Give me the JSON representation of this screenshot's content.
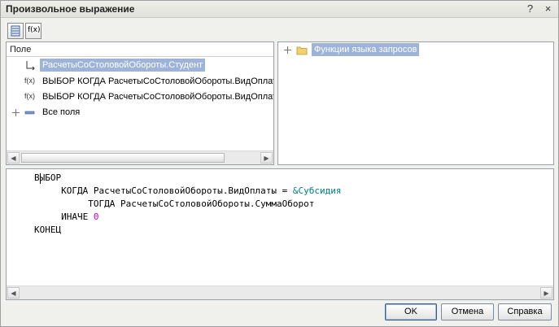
{
  "window": {
    "title": "Произвольное выражение",
    "help_glyph": "?",
    "close_glyph": "×"
  },
  "toolbar": {
    "buttons": [
      {
        "icon": "list-icon"
      },
      {
        "icon": "function-icon",
        "glyph": "f(x)"
      }
    ]
  },
  "fields_panel": {
    "header": "Поле",
    "rows": [
      {
        "icon": "hierarchy-icon",
        "glyph": "⌐",
        "label": "РасчетыСоСтоловойОбороты.Студент",
        "selected": true
      },
      {
        "icon": "function-icon",
        "glyph": "f(x)",
        "label": "ВЫБОР КОГДА РасчетыСоСтоловойОбороты.ВидОплаты",
        "selected": false
      },
      {
        "icon": "function-icon",
        "glyph": "f(x)",
        "label": "ВЫБОР КОГДА РасчетыСоСтоловойОбороты.ВидОплаты",
        "selected": false
      },
      {
        "icon": "minus-field-icon",
        "glyph": "−",
        "label": "Все поля",
        "selected": false,
        "expandable": true
      }
    ]
  },
  "functions_panel": {
    "rows": [
      {
        "icon": "folder-icon",
        "label": "Функции языка запросов",
        "selected": true,
        "expandable": true
      }
    ]
  },
  "editor": {
    "lines": [
      {
        "indent": "",
        "parts": [
          {
            "t": "ВЫБОР",
            "c": "kw"
          }
        ]
      },
      {
        "indent": "     ",
        "parts": [
          {
            "t": "КОГДА РасчетыСоСтоловойОбороты.ВидОплаты = ",
            "c": "kw"
          },
          {
            "t": "&Субсидия",
            "c": "param"
          }
        ]
      },
      {
        "indent": "          ",
        "parts": [
          {
            "t": "ТОГДА РасчетыСоСтоловойОбороты.СуммаОборот",
            "c": "kw"
          }
        ]
      },
      {
        "indent": "     ",
        "parts": [
          {
            "t": "ИНАЧЕ ",
            "c": "kw"
          },
          {
            "t": "0",
            "c": "num"
          }
        ]
      },
      {
        "indent": "",
        "parts": [
          {
            "t": "КОНЕЦ",
            "c": "kw"
          }
        ]
      }
    ]
  },
  "buttons": {
    "ok": "OK",
    "cancel": "Отмена",
    "help": "Справка"
  },
  "colors": {
    "selection": "#9db3d8",
    "parameter": "#008080",
    "number": "#c000c0"
  }
}
